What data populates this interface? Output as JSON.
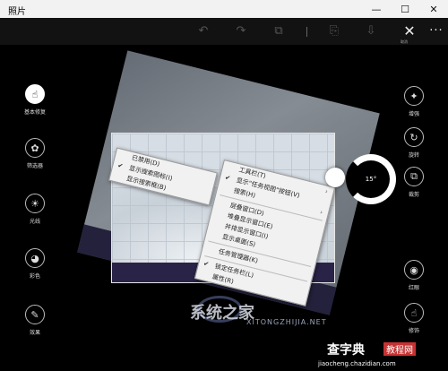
{
  "window": {
    "title": "照片",
    "controls": [
      "—",
      "☐",
      "✕"
    ]
  },
  "toolbar": {
    "icons": [
      "undo-icon",
      "redo-icon",
      "compare-icon",
      "save-copy-icon",
      "save-icon"
    ],
    "close_label": "取消",
    "more": "···"
  },
  "left_tools": [
    {
      "label": "基本修复",
      "icon": "☝",
      "active": true
    },
    {
      "label": "筛选器",
      "icon": "✿",
      "active": false
    },
    {
      "label": "光线",
      "icon": "☀",
      "active": false
    },
    {
      "label": "彩色",
      "icon": "◕",
      "active": false
    },
    {
      "label": "效果",
      "icon": "✎",
      "active": false
    }
  ],
  "right_tools": [
    {
      "label": "增强",
      "icon": "✦"
    },
    {
      "label": "旋转",
      "icon": "↻"
    },
    {
      "label": "裁剪",
      "icon": "⧉"
    },
    {
      "label": "红眼",
      "icon": "◉"
    },
    {
      "label": "修饰",
      "icon": "☝"
    }
  ],
  "menu_left": [
    {
      "label": "已禁用(D)",
      "checked": false
    },
    {
      "label": "显示搜索图标(I)",
      "checked": true
    },
    {
      "label": "显示搜索框(B)",
      "checked": false
    }
  ],
  "menu_right": [
    {
      "label": "工具栏(T)",
      "checked": false,
      "submenu": true
    },
    {
      "label": "显示\"任务视图\"按钮(V)",
      "checked": true
    },
    {
      "label": "搜索(H)",
      "checked": false,
      "submenu": true
    },
    {
      "label": "层叠窗口(D)",
      "checked": false
    },
    {
      "label": "堆叠显示窗口(E)",
      "checked": false
    },
    {
      "label": "并排显示窗口(I)",
      "checked": false
    },
    {
      "label": "显示桌面(S)",
      "checked": false
    },
    {
      "label": "任务管理器(K)",
      "checked": false
    },
    {
      "label": "锁定任务栏(L)",
      "checked": true
    },
    {
      "label": "属性(R)",
      "checked": false
    }
  ],
  "rotation": {
    "angle_label": "15°"
  },
  "watermarks": {
    "site1": "系统之家",
    "site1_sub": "XITONGZHIJIA.NET",
    "site2": "查字典",
    "site2_badge": "教程网",
    "site2_sub": "jiaocheng.chazidian.com"
  }
}
